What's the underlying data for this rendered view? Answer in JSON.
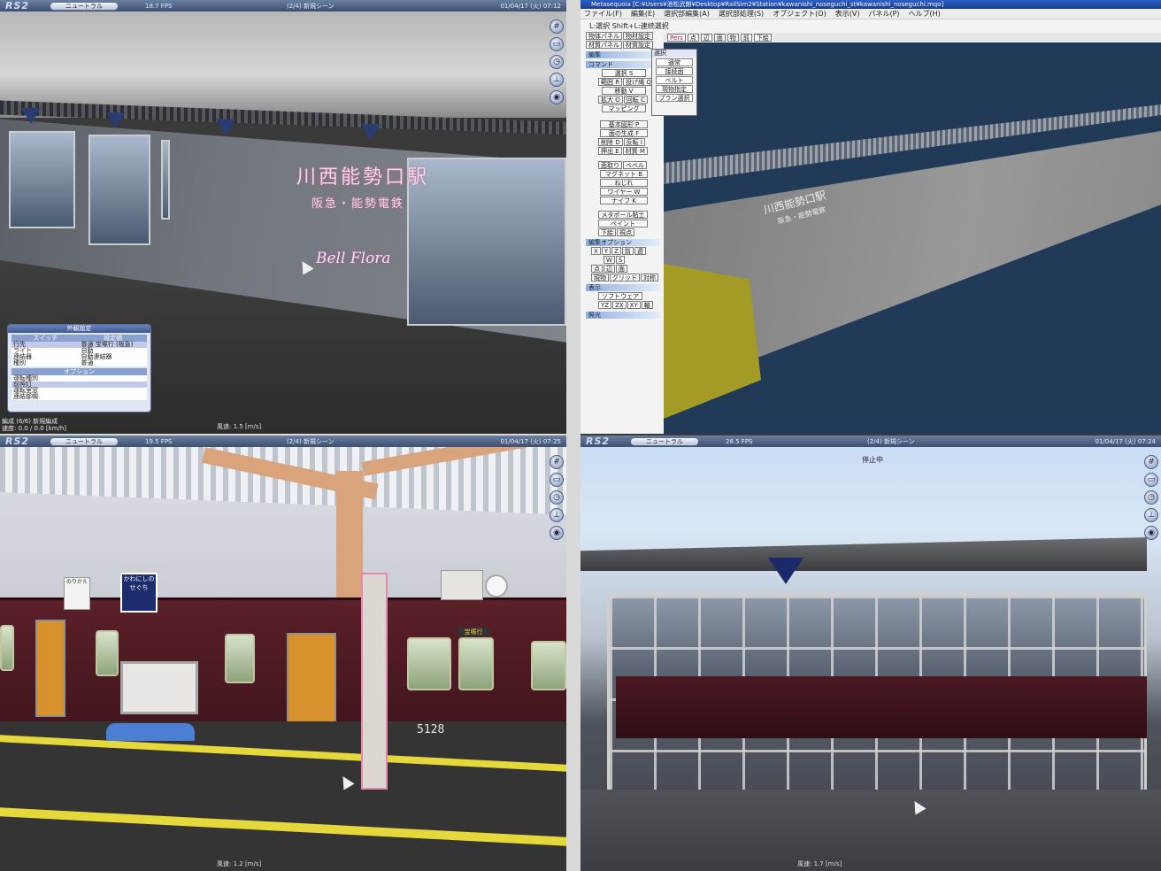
{
  "rs2": {
    "logo": "RS2",
    "mode_button": "ニュートラル",
    "top_left": {
      "fps": "18.7 FPS",
      "scene": "(2/4) 新規シーン",
      "time": "01/04/17 (火) 07:12",
      "wind": "風速: 1.5 [m/s]",
      "status_line1": "編成 (6/6) 新規編成",
      "status_line2": "速度: 0.0 / 0.0 [km/h]"
    },
    "bottom_left": {
      "fps": "19.5 FPS",
      "scene": "(2/4) 新規シーン",
      "time": "01/04/17 (火) 07:25",
      "wind": "風速: 1.2 [m/s]"
    },
    "bottom_right": {
      "fps": "28.5 FPS",
      "scene": "(2/4) 新規シーン",
      "time": "01/04/17 (火) 07:24",
      "wind": "風速: 1.7 [m/s]",
      "stopped": "停止中"
    }
  },
  "scene_tl": {
    "station_name": "川西能勢口駅",
    "station_sub": "阪急・能勢電鉄",
    "logo_text": "Bell Flora"
  },
  "appearance_window": {
    "title": "外観設定",
    "header_switch": "スイッチ",
    "header_value": "設定値",
    "rows": [
      {
        "switch": "行先",
        "value": "普通 宝塚行 (阪急)",
        "selected": true
      },
      {
        "switch": "ライト",
        "value": "自動",
        "selected": false
      },
      {
        "switch": "連結器",
        "value": "自動連結器",
        "selected": false
      },
      {
        "switch": "種別",
        "value": "普通",
        "selected": false
      }
    ],
    "option_header": "オプション",
    "options": [
      {
        "label": "運転種別",
        "selected": false
      },
      {
        "label": "前照灯",
        "selected": true
      },
      {
        "label": "運転室窓",
        "selected": false
      },
      {
        "label": "連結部幌",
        "selected": false
      }
    ]
  },
  "metasequoia": {
    "title": "Metasequoia [C:¥Users¥池松武朗¥Desktop¥RailSim2¥Station¥kawanishi_noseguchi_st¥kawanishi_noseguchi.mqo]",
    "menu": [
      "ファイル(F)",
      "編集(E)",
      "選択部編集(A)",
      "選択部処理(S)",
      "オブジェクト(O)",
      "表示(V)",
      "パネル(P)",
      "ヘルプ(H)"
    ],
    "hint": "L:選択  Shift+L:連続選択",
    "panel_buttons": [
      [
        "物体パネル",
        "物材設定"
      ],
      [
        "材質パネル",
        "材質設定"
      ]
    ],
    "section_edit": "編集",
    "section_command": "コマンド",
    "commands": [
      [
        "選択 S"
      ],
      [
        "範囲 R",
        "投げ縄 Q"
      ],
      [
        "移動 V"
      ],
      [
        "拡大 O",
        "回転 C"
      ],
      [
        "マッピング"
      ],
      [
        "基本図形 P"
      ],
      [
        "面の生成 F"
      ],
      [
        "削除 D",
        "反転 I"
      ],
      [
        "押出 E",
        "材質 M"
      ],
      [
        "面取り",
        "ベベル"
      ],
      [
        "マグネット B"
      ],
      [
        "ねじれ"
      ],
      [
        "ワイヤー W"
      ],
      [
        "ナイフ K"
      ],
      [
        "メタボール粘土"
      ],
      [
        "ペイント"
      ],
      [
        "下絵",
        "視点"
      ]
    ],
    "section_edit_option": "編集オプション",
    "axis_buttons": [
      "X",
      "Y",
      "Z",
      "前",
      "週"
    ],
    "coord_buttons": [
      "W",
      "S"
    ],
    "select_types": [
      "点",
      "辺",
      "面"
    ],
    "visible_buttons": [
      "現物",
      "グリッド",
      "対称"
    ],
    "section_display": "表示",
    "display_mode": "ソフトウェア",
    "view_axes": [
      "YZ",
      "ZX",
      "XY",
      "軸"
    ],
    "section_light": "照光",
    "view_toolbar": [
      "Pers",
      "点",
      "辺",
      "面",
      "物",
      "前",
      "下絵"
    ],
    "popup_title": "選択",
    "popup_items": [
      "通常",
      "接続面",
      "ベルト",
      "現物指定",
      "プラン選択"
    ],
    "model_sign": "川西能勢口駅",
    "model_sign_sub": "阪急・能勢電鉄"
  },
  "scene_bl": {
    "car_number": "5128",
    "sign_blue": "かわにしのせぐち",
    "sign_white": "のりかえ",
    "dest_label": "宝塚行"
  }
}
